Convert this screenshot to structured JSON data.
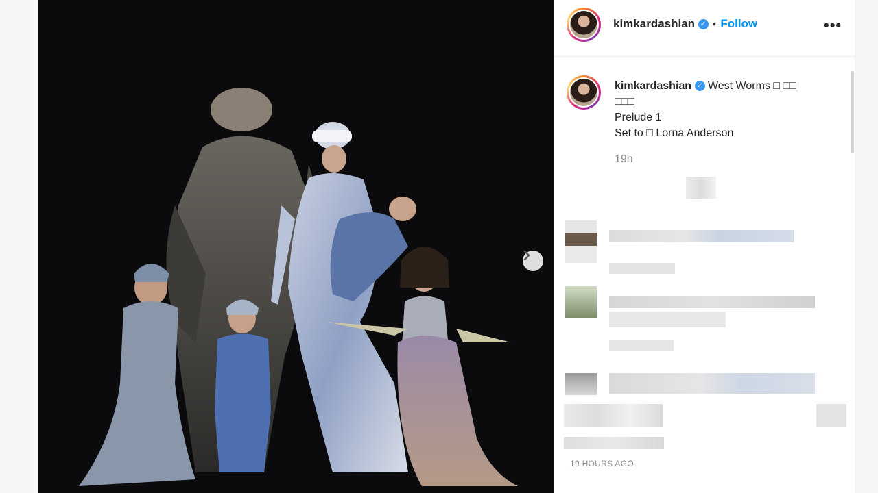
{
  "post": {
    "username": "kimkardashian",
    "separator": "•",
    "follow_label": "Follow",
    "more_options": "•••",
    "verified_mark": "✓"
  },
  "caption": {
    "username": "kimkardashian",
    "line1": "West Worms □ □□",
    "line2": "□□□",
    "line3": "Prelude 1",
    "line4": "Set to □ Lorna Anderson",
    "timestamp": "19h"
  },
  "footer": {
    "timestamp": "19 HOURS AGO"
  },
  "icons": {
    "next": "chevron-right-icon",
    "verified": "verified-badge-icon",
    "more": "more-options-icon"
  },
  "colors": {
    "link": "#0095f6",
    "verified": "#3897f0",
    "photo_bg": "#0b0b0d"
  }
}
